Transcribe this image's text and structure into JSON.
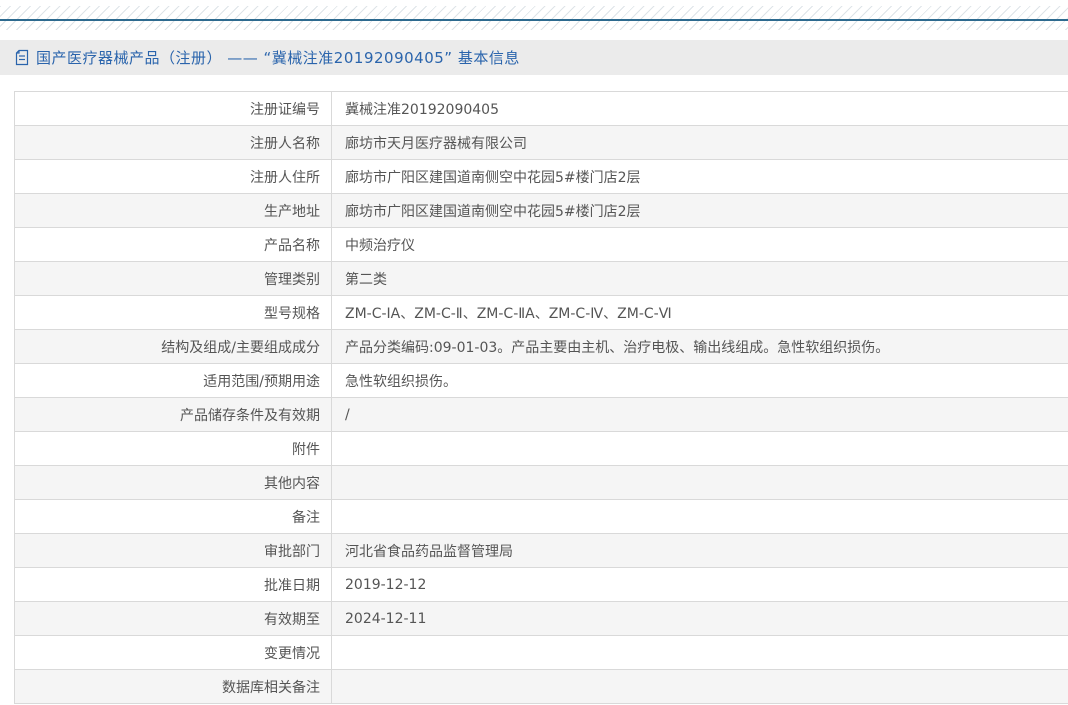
{
  "header": {
    "icon": "document-icon",
    "title": "国产医疗器械产品（注册） —— “冀械注准20192090405” 基本信息"
  },
  "colors": {
    "accent_blue": "#2a64ac",
    "top_rule_teal": "#2d6a8f",
    "header_bar_gray": "#ebebeb",
    "row_alt_gray": "#f5f5f5",
    "border_gray": "#d9d9d9",
    "text_gray": "#555555"
  },
  "table": {
    "rows": [
      {
        "label": "注册证编号",
        "value": "冀械注准20192090405"
      },
      {
        "label": "注册人名称",
        "value": "廊坊市天月医疗器械有限公司"
      },
      {
        "label": "注册人住所",
        "value": "廊坊市广阳区建国道南侧空中花园5#楼门店2层"
      },
      {
        "label": "生产地址",
        "value": "廊坊市广阳区建国道南侧空中花园5#楼门店2层"
      },
      {
        "label": "产品名称",
        "value": "中频治疗仪"
      },
      {
        "label": "管理类别",
        "value": "第二类"
      },
      {
        "label": "型号规格",
        "value": "ZM-C-ⅠA、ZM-C-Ⅱ、ZM-C-ⅡA、ZM-C-Ⅳ、ZM-C-Ⅵ"
      },
      {
        "label": "结构及组成/主要组成成分",
        "value": "产品分类编码:09-01-03。产品主要由主机、治疗电极、输出线组成。急性软组织损伤。"
      },
      {
        "label": "适用范围/预期用途",
        "value": "急性软组织损伤。"
      },
      {
        "label": "产品储存条件及有效期",
        "value": "/"
      },
      {
        "label": "附件",
        "value": ""
      },
      {
        "label": "其他内容",
        "value": ""
      },
      {
        "label": "备注",
        "value": ""
      },
      {
        "label": "审批部门",
        "value": "河北省食品药品监督管理局"
      },
      {
        "label": "批准日期",
        "value": "2019-12-12"
      },
      {
        "label": "有效期至",
        "value": "2024-12-11"
      },
      {
        "label": "变更情况",
        "value": ""
      },
      {
        "label": "数据库相关备注",
        "value": ""
      }
    ]
  }
}
